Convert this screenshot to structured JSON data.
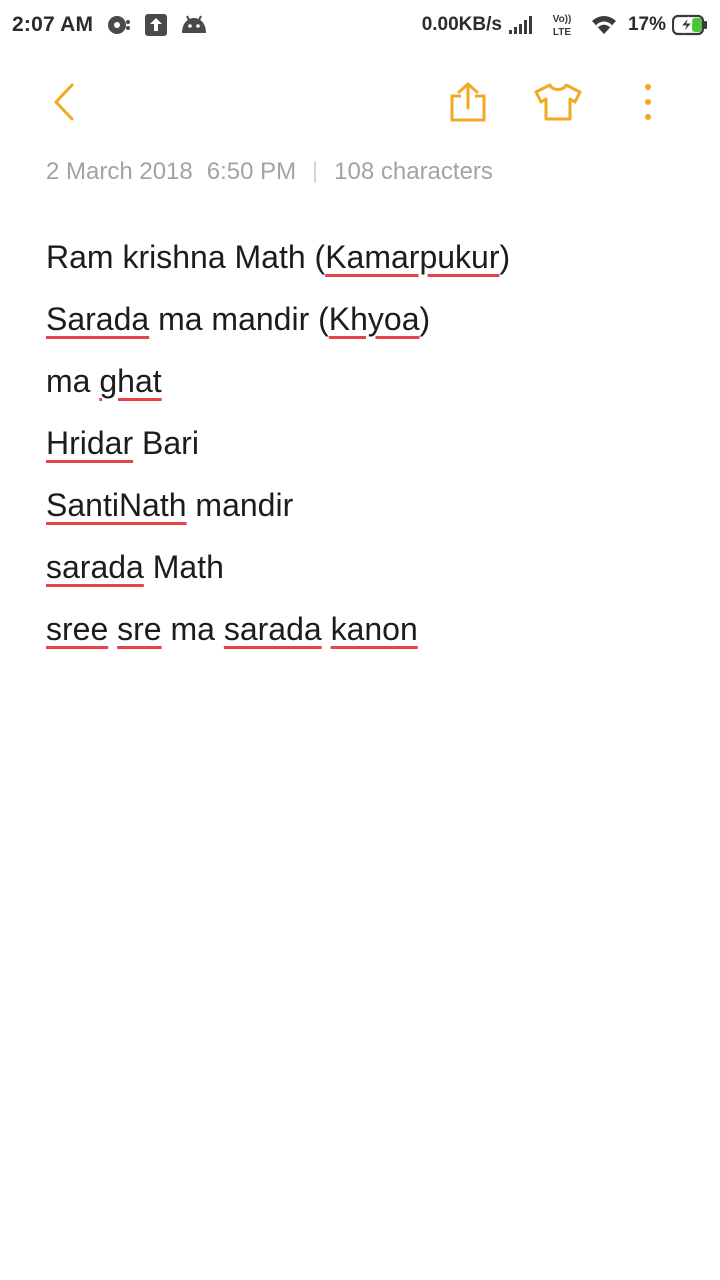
{
  "status_bar": {
    "time": "2:07 AM",
    "net_speed": "0.00KB/s",
    "volte_label_top": "Vo))",
    "volte_label_bottom": "LTE",
    "battery_percent": "17%",
    "icons": [
      "disc-icon",
      "upload-icon",
      "android-icon",
      "signal-icon",
      "volte-icon",
      "wifi-icon",
      "battery-charging-icon"
    ]
  },
  "toolbar": {
    "accent_color": "#F2A922",
    "icons": [
      "back-arrow-icon",
      "share-icon",
      "shirt-theme-icon",
      "more-vertical-icon"
    ]
  },
  "note": {
    "date": "2 March 2018",
    "time": "6:50 PM",
    "char_count": "108 characters",
    "lines": [
      [
        {
          "t": "Ram krishna Math ("
        },
        {
          "t": "Kamarpukur",
          "spell": true
        },
        {
          "t": ")"
        }
      ],
      [
        {
          "t": "Sarada",
          "spell": true
        },
        {
          "t": " ma mandir ("
        },
        {
          "t": "Khyoa",
          "spell": true
        },
        {
          "t": ")"
        }
      ],
      [
        {
          "t": "ma "
        },
        {
          "t": "ghat",
          "spell": true
        }
      ],
      [
        {
          "t": "Hridar",
          "spell": true
        },
        {
          "t": " Bari"
        }
      ],
      [
        {
          "t": "SantiNath",
          "spell": true
        },
        {
          "t": " mandir"
        }
      ],
      [
        {
          "t": "sarada",
          "spell": true
        },
        {
          "t": " Math"
        }
      ],
      [
        {
          "t": "sree",
          "spell": true
        },
        {
          "t": " "
        },
        {
          "t": "sre",
          "spell": true
        },
        {
          "t": " ma "
        },
        {
          "t": "sarada",
          "spell": true
        },
        {
          "t": " "
        },
        {
          "t": "kanon",
          "spell": true
        }
      ]
    ],
    "spellcheck_color": "#E8434A"
  }
}
